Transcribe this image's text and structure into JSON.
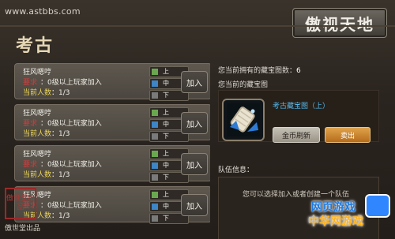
{
  "watermark_url": "www.astbbs.com",
  "game_logo_text": "傲视天地",
  "panel_title": "考古",
  "expedition_cards": [
    {
      "name": "狂风嗯哼",
      "req_tag": "要求",
      "requirement": "：0级以上玩家加入",
      "count_label": "当前人数",
      "count_value": "1/3",
      "join_label": "加入"
    },
    {
      "name": "狂风嗯哼",
      "req_tag": "要求",
      "requirement": "：0级以上玩家加入",
      "count_label": "当前人数",
      "count_value": "1/3",
      "join_label": "加入"
    },
    {
      "name": "狂风嗯哼",
      "req_tag": "要求",
      "requirement": "：0级以上玩家加入",
      "count_label": "当前人数",
      "count_value": "1/3",
      "join_label": "加入"
    },
    {
      "name": "狂风嗯哼",
      "req_tag": "要求",
      "requirement": "：0级以上玩家加入",
      "count_label": "当前人数",
      "count_value": "1/3",
      "join_label": "加入"
    }
  ],
  "lanes": [
    "上",
    "中",
    "下"
  ],
  "lane_colors": [
    "#6aa84f",
    "#3d85c6",
    "#7a7a7a"
  ],
  "right_panel": {
    "owned_label": "您当前拥有的藏宝图数：",
    "owned_value": "6",
    "current_label": "您当前的藏宝图",
    "current_map_name": "考古藏宝图（上）",
    "gold_refresh_label": "金币刷新",
    "sell_label": "卖出",
    "team_info_label": "队伍信息：",
    "team_hint": "您可以选择加入或者创建一个队伍"
  },
  "seal_text": "傲世堂出品",
  "studio_credit": "傲世堂出品",
  "badge": {
    "line1": "网页游戏",
    "line2": "中华网游戏"
  },
  "colors": {
    "accent_red": "#d23b3b",
    "accent_gold": "#ebd45a",
    "link_blue": "#55b6ea",
    "sell_orange": "#d58a2b"
  }
}
